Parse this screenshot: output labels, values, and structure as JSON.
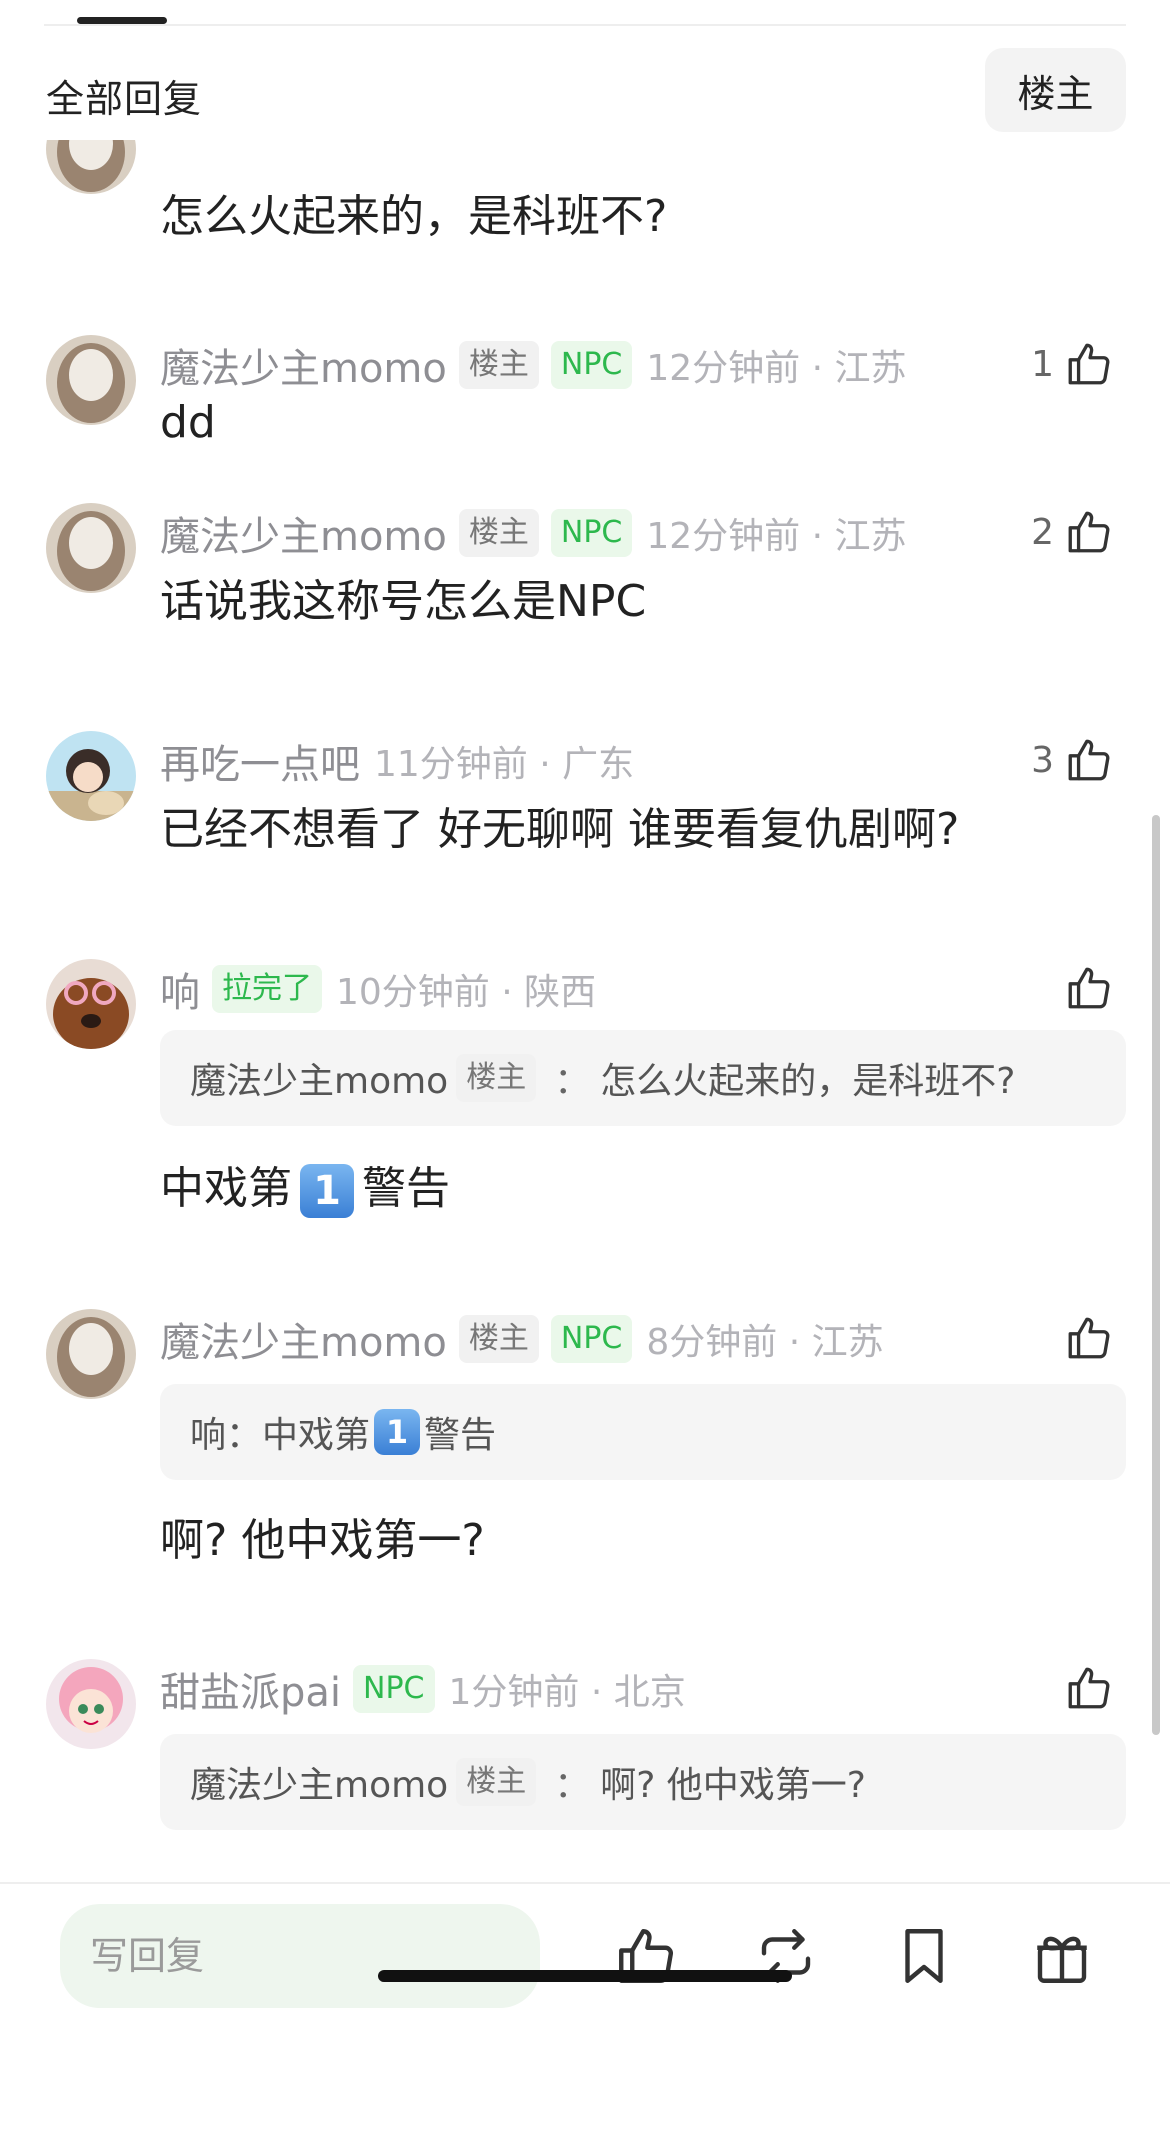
{
  "header": {
    "title": "全部回复",
    "owner_filter": "楼主"
  },
  "comments": [
    {
      "body": "怎么火起来的，是科班不?"
    },
    {
      "username": "魔法少主momo",
      "tag_owner": "楼主",
      "tag_npc": "NPC",
      "time_location": "12分钟前 · 江苏",
      "likes": "1",
      "body": "dd"
    },
    {
      "username": "魔法少主momo",
      "tag_owner": "楼主",
      "tag_npc": "NPC",
      "time_location": "12分钟前 · 江苏",
      "likes": "2",
      "body": "话说我这称号怎么是NPC"
    },
    {
      "username": "再吃一点吧",
      "time_location": "11分钟前 · 广东",
      "likes": "3",
      "body": "已经不想看了 好无聊啊 谁要看复仇剧啊?"
    },
    {
      "username": "响",
      "tag_title": "拉完了",
      "time_location": "10分钟前 · 陕西",
      "quote_user": "魔法少主momo",
      "quote_tag": "楼主",
      "quote_sep": "：",
      "quote_text": "怎么火起来的，是科班不?",
      "body_before": "中戏第",
      "emoji": "1",
      "body_after": "警告"
    },
    {
      "username": "魔法少主momo",
      "tag_owner": "楼主",
      "tag_npc": "NPC",
      "time_location": "8分钟前 · 江苏",
      "quote_user": "响：",
      "quote_text_before": "中戏第",
      "quote_emoji": "1",
      "quote_text_after": "警告",
      "body": "啊? 他中戏第一?"
    },
    {
      "username": "甜盐派pai",
      "tag_npc": "NPC",
      "time_location": "1分钟前 · 北京",
      "quote_user": "魔法少主momo",
      "quote_tag": "楼主",
      "quote_sep": "：",
      "quote_text": "啊? 他中戏第一?"
    }
  ],
  "bottom_bar": {
    "reply_placeholder": "写回复"
  },
  "icons": {
    "like": "thumbs-up-icon",
    "repost": "repost-icon",
    "bookmark": "bookmark-icon",
    "gift": "gift-icon"
  },
  "colors": {
    "green_tag": "#2db84d",
    "green_tag_bg": "#eaf8ea",
    "input_bg": "#eef6ee"
  }
}
